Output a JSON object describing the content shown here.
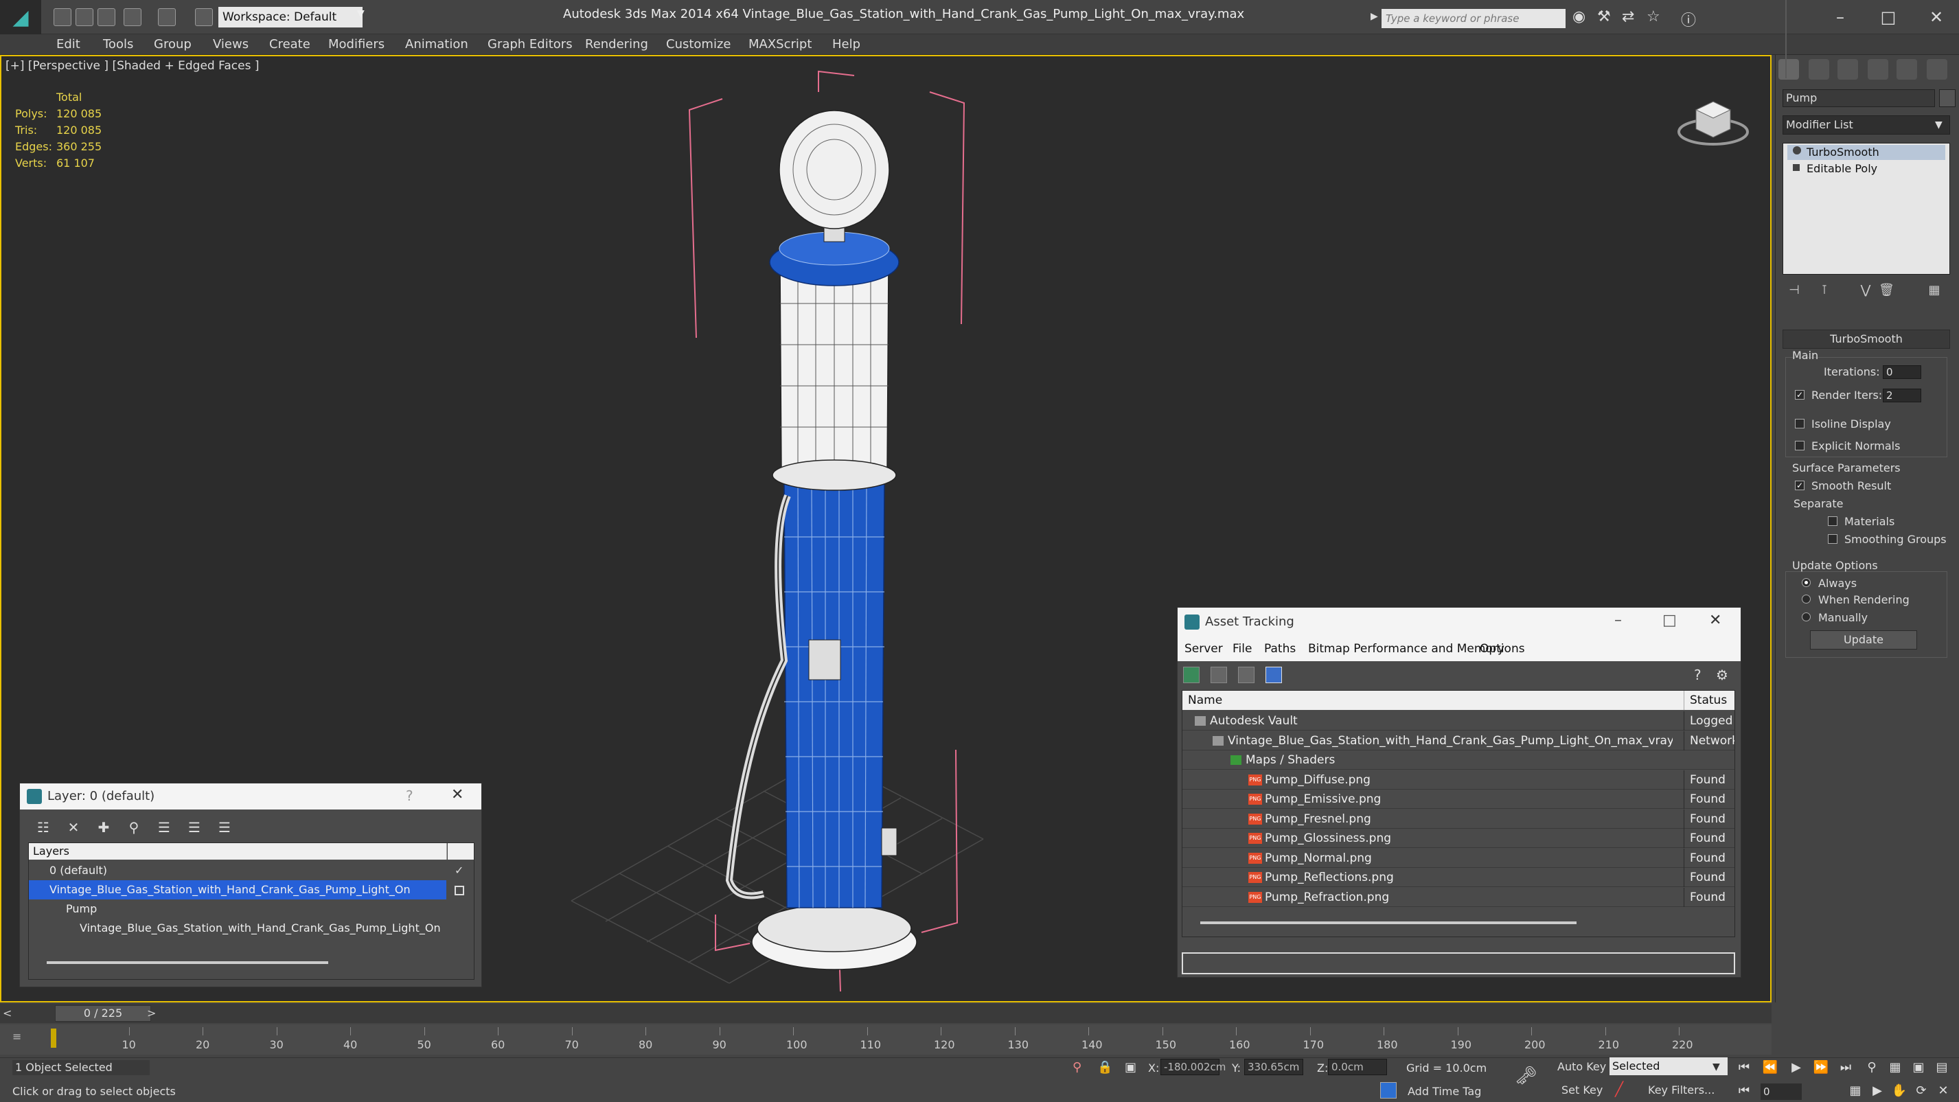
{
  "app": {
    "workspace": "Workspace: Default",
    "title": "Autodesk 3ds Max  2014 x64      Vintage_Blue_Gas_Station_with_Hand_Crank_Gas_Pump_Light_On_max_vray.max",
    "search_placeholder": "Type a keyword or phrase"
  },
  "menu": [
    "Edit",
    "Tools",
    "Group",
    "Views",
    "Create",
    "Modifiers",
    "Animation",
    "Graph Editors",
    "Rendering",
    "Customize",
    "MAXScript",
    "Help"
  ],
  "viewport": {
    "label": "[+] [Perspective ] [Shaded + Edged Faces ]",
    "stats": {
      "total_label": "Total",
      "rows": [
        {
          "label": "Polys:",
          "value": "120 085"
        },
        {
          "label": "Tris:",
          "value": "120 085"
        },
        {
          "label": "Edges:",
          "value": "360 255"
        },
        {
          "label": "Verts:",
          "value": "61 107"
        }
      ]
    }
  },
  "command_panel": {
    "object_name": "Pump",
    "modifier_list": "Modifier List",
    "stack": [
      {
        "label": "TurboSmooth",
        "selected": true
      },
      {
        "label": "Editable Poly",
        "selected": false
      }
    ],
    "rollout_title": "TurboSmooth",
    "main_label": "Main",
    "iterations_label": "Iterations:",
    "iterations_value": "0",
    "render_iters_label": "Render Iters:",
    "render_iters_value": "2",
    "isoline_label": "Isoline Display",
    "explicit_label": "Explicit Normals",
    "surface_label": "Surface Parameters",
    "smooth_label": "Smooth Result",
    "separate_label": "Separate",
    "materials_label": "Materials",
    "smoothing_groups_label": "Smoothing Groups",
    "update_options_label": "Update Options",
    "always_label": "Always",
    "when_rendering_label": "When Rendering",
    "manually_label": "Manually",
    "update_button": "Update"
  },
  "layer_dialog": {
    "title": "Layer: 0 (default)",
    "header": "Layers",
    "rows": [
      {
        "label": "0 (default)",
        "indent": 1,
        "selected": false
      },
      {
        "label": "Vintage_Blue_Gas_Station_with_Hand_Crank_Gas_Pump_Light_On",
        "indent": 1,
        "selected": true
      },
      {
        "label": "Pump",
        "indent": 2,
        "selected": false
      },
      {
        "label": "Vintage_Blue_Gas_Station_with_Hand_Crank_Gas_Pump_Light_On",
        "indent": 2,
        "selected": false
      }
    ]
  },
  "asset_dialog": {
    "title": "Asset Tracking",
    "menu": [
      "Server",
      "File",
      "Paths",
      "Bitmap Performance and Memory",
      "Options"
    ],
    "col_name": "Name",
    "col_status": "Status",
    "rows": [
      {
        "name": "Autodesk Vault",
        "status": "Logged Out",
        "indent": 1,
        "icon": false
      },
      {
        "name": "Vintage_Blue_Gas_Station_with_Hand_Crank_Gas_Pump_Light_On_max_vray.max",
        "status": "Network",
        "indent": 2,
        "icon": false
      },
      {
        "name": "Maps / Shaders",
        "status": "",
        "indent": 3,
        "icon": false
      },
      {
        "name": "Pump_Diffuse.png",
        "status": "Found",
        "indent": 4,
        "icon": true
      },
      {
        "name": "Pump_Emissive.png",
        "status": "Found",
        "indent": 4,
        "icon": true
      },
      {
        "name": "Pump_Fresnel.png",
        "status": "Found",
        "indent": 4,
        "icon": true
      },
      {
        "name": "Pump_Glossiness.png",
        "status": "Found",
        "indent": 4,
        "icon": true
      },
      {
        "name": "Pump_Normal.png",
        "status": "Found",
        "indent": 4,
        "icon": true
      },
      {
        "name": "Pump_Reflections.png",
        "status": "Found",
        "indent": 4,
        "icon": true
      },
      {
        "name": "Pump_Refraction.png",
        "status": "Found",
        "indent": 4,
        "icon": true
      }
    ],
    "file_icon_text": "PNG"
  },
  "timeline": {
    "slider": "0 / 225",
    "ticks": [
      "10",
      "20",
      "30",
      "40",
      "50",
      "60",
      "70",
      "80",
      "90",
      "100",
      "110",
      "120",
      "130",
      "140",
      "150",
      "160",
      "170",
      "180",
      "190",
      "200",
      "210",
      "220"
    ]
  },
  "status": {
    "selection": "1 Object Selected",
    "prompt": "Click or drag to select objects",
    "x_label": "X:",
    "x_value": "-180.002cm",
    "y_label": "Y:",
    "y_value": "330.65cm",
    "z_label": "Z:",
    "z_value": "0.0cm",
    "grid": "Grid = 10.0cm",
    "add_time_tag": "Add Time Tag",
    "auto_key": "Auto Key",
    "set_key": "Set Key",
    "key_mode": "Selected",
    "key_filters": "Key Filters...",
    "frame": "0"
  }
}
